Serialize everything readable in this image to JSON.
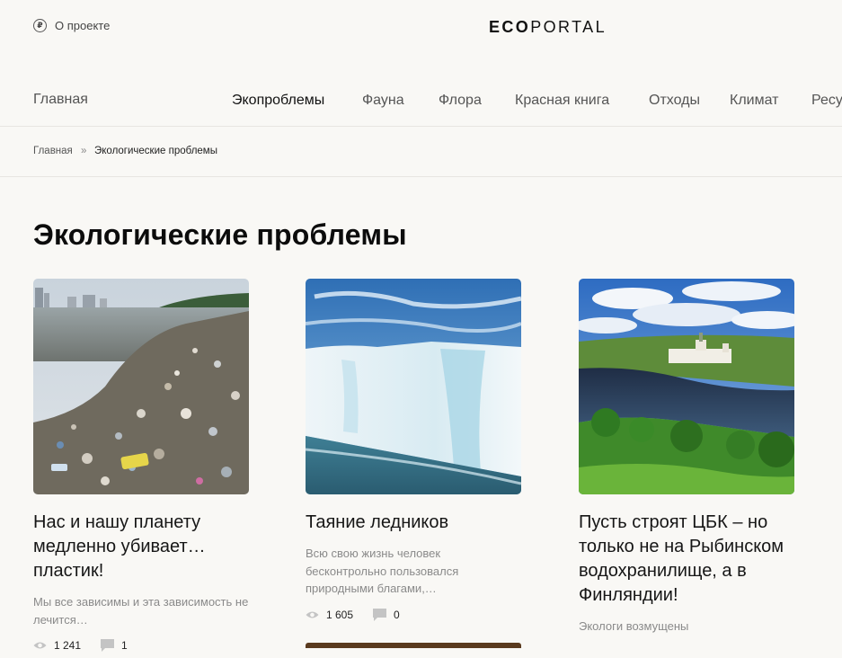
{
  "header": {
    "about": {
      "icon": "ruble-circle-icon",
      "glyph": "₽",
      "label": "О проекте"
    },
    "logo": {
      "bold": "ECO",
      "light": "PORTAL"
    }
  },
  "nav": {
    "home": "Главная",
    "items": [
      {
        "label": "Экопроблемы",
        "active": true
      },
      {
        "label": "Фауна"
      },
      {
        "label": "Флора"
      },
      {
        "label": "Красная книга"
      },
      {
        "label": "Отходы"
      },
      {
        "label": "Климат"
      },
      {
        "label": "Ресу"
      }
    ]
  },
  "breadcrumbs": {
    "home": "Главная",
    "separator": "»",
    "current": "Экологические проблемы"
  },
  "page": {
    "title": "Экологические проблемы"
  },
  "cards": [
    {
      "title": "Нас и нашу планету медленно убивает… пластик!",
      "excerpt": "Мы все зависимы и эта зависимость не лечится…",
      "views": "1 241",
      "comments": "1",
      "image": "plastic-polluted-beach"
    },
    {
      "title": "Таяние ледников",
      "excerpt": "Всю свою жизнь человек бесконтрольно пользовался природными благами,…",
      "views": "1 605",
      "comments": "0",
      "image": "melting-glacier"
    },
    {
      "title": "Пусть строят ЦБК – но только не на Рыбинском водохранилище, а в Финляндии!",
      "excerpt": "Экологи возмущены",
      "image": "river-monastery-landscape"
    }
  ],
  "icons": {
    "views": "eye-icon",
    "comments": "comment-icon"
  },
  "colors": {
    "background": "#f9f8f5",
    "text": "#1d1d1d",
    "muted": "#8a8a8a",
    "divider": "#e8e6e1"
  }
}
